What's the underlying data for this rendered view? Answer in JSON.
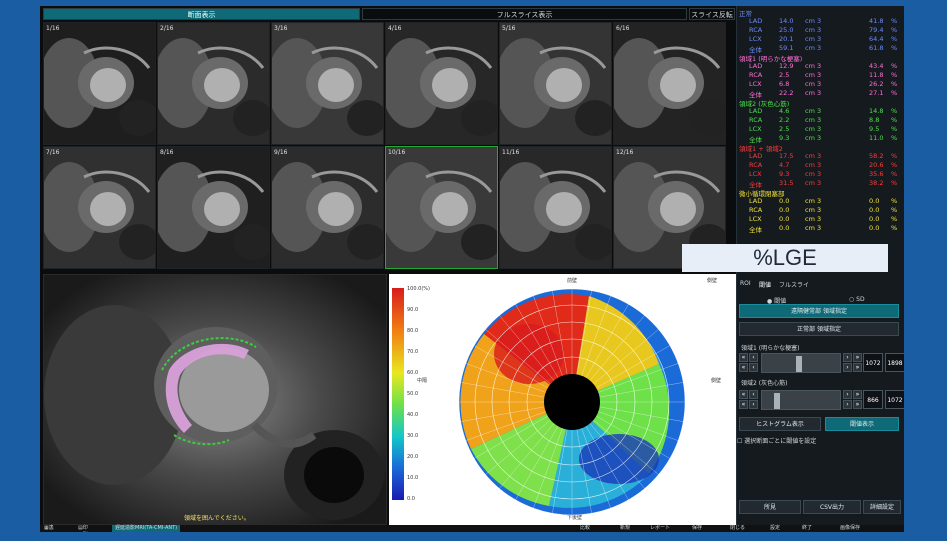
{
  "tabs": [
    {
      "label": "断面表示"
    },
    {
      "label": "フルスライス表示"
    },
    {
      "label": "スライス反転"
    }
  ],
  "slices": [
    "1/16",
    "2/16",
    "3/16",
    "4/16",
    "5/16",
    "6/16",
    "7/16",
    "8/16",
    "9/16",
    "10/16",
    "11/16",
    "12/16"
  ],
  "main_note": "領域を囲んでください。",
  "bullseye": {
    "top": "前壁",
    "bottom": "下後壁",
    "left": "中隔",
    "right": "側壁",
    "corner": "側壁",
    "colorbar": [
      "100.0(%)",
      "90.0",
      "80.0",
      "70.0",
      "60.0",
      "50.0",
      "40.0",
      "30.0",
      "20.0",
      "10.0",
      "0.0"
    ]
  },
  "legend": {
    "groups": [
      {
        "title": "正常",
        "color": "#6b8cff",
        "rows": [
          {
            "name": "LAD",
            "val": "14.0",
            "unit": "cm 3",
            "pct": "41.8",
            "p": "%"
          },
          {
            "name": "RCA",
            "val": "25.0",
            "unit": "cm 3",
            "pct": "79.4",
            "p": "%"
          },
          {
            "name": "LCX",
            "val": "20.1",
            "unit": "cm 3",
            "pct": "64.4",
            "p": "%"
          },
          {
            "name": "全体",
            "val": "59.1",
            "unit": "cm 3",
            "pct": "61.8",
            "p": "%"
          }
        ]
      },
      {
        "title": "領域1 (明らかな梗塞)",
        "color": "#ff6fd8",
        "rows": [
          {
            "name": "LAD",
            "val": "12.9",
            "unit": "cm 3",
            "pct": "43.4",
            "p": "%"
          },
          {
            "name": "RCA",
            "val": "2.5",
            "unit": "cm 3",
            "pct": "11.8",
            "p": "%"
          },
          {
            "name": "LCX",
            "val": "6.8",
            "unit": "cm 3",
            "pct": "26.2",
            "p": "%"
          },
          {
            "name": "全体",
            "val": "22.2",
            "unit": "cm 3",
            "pct": "27.1",
            "p": "%"
          }
        ]
      },
      {
        "title": "領域2 (灰色心筋)",
        "color": "#4ce04c",
        "rows": [
          {
            "name": "LAD",
            "val": "4.6",
            "unit": "cm 3",
            "pct": "14.8",
            "p": "%"
          },
          {
            "name": "RCA",
            "val": "2.2",
            "unit": "cm 3",
            "pct": "8.8",
            "p": "%"
          },
          {
            "name": "LCX",
            "val": "2.5",
            "unit": "cm 3",
            "pct": "9.5",
            "p": "%"
          },
          {
            "name": "全体",
            "val": "9.3",
            "unit": "cm 3",
            "pct": "11.0",
            "p": "%"
          }
        ]
      },
      {
        "title": "領域1 + 領域2",
        "color": "#ff3b3b",
        "rows": [
          {
            "name": "LAD",
            "val": "17.5",
            "unit": "cm 3",
            "pct": "58.2",
            "p": "%"
          },
          {
            "name": "RCA",
            "val": "4.7",
            "unit": "cm 3",
            "pct": "20.6",
            "p": "%"
          },
          {
            "name": "LCX",
            "val": "9.3",
            "unit": "cm 3",
            "pct": "35.6",
            "p": "%"
          },
          {
            "name": "全体",
            "val": "31.5",
            "unit": "cm 3",
            "pct": "38.2",
            "p": "%"
          }
        ]
      },
      {
        "title": "微小循環閉塞部",
        "color": "#f2e23a",
        "rows": [
          {
            "name": "LAD",
            "val": "0.0",
            "unit": "cm 3",
            "pct": "0.0",
            "p": "%"
          },
          {
            "name": "RCA",
            "val": "0.0",
            "unit": "cm 3",
            "pct": "0.0",
            "p": "%"
          },
          {
            "name": "LCX",
            "val": "0.0",
            "unit": "cm 3",
            "pct": "0.0",
            "p": "%"
          },
          {
            "name": "全体",
            "val": "0.0",
            "unit": "cm 3",
            "pct": "0.0",
            "p": "%"
          }
        ]
      }
    ]
  },
  "lge_label": "%LGE",
  "controls": {
    "tabs": [
      "ROI",
      "閾値",
      "フルスライ"
    ],
    "radio_threshold": "閾値",
    "radio_sd": "SD",
    "btn_remote_normal": "遠隔健常部 領域指定",
    "btn_normal": "正常部 領域指定",
    "region1_label": "領域1 (明らかな梗塞)",
    "region1_min": "1072",
    "region1_max": "1898",
    "region2_label": "領域2 (灰色心筋)",
    "region2_min": "866",
    "region2_max": "1072",
    "btn_histogram": "ヒストグラム表示",
    "btn_threshold_show": "閾値表示",
    "chk_slice": "選択断面ごとに閾値を設定",
    "btn_findings": "所見",
    "btn_csv": "CSV出力",
    "btn_settings": "詳細設定"
  },
  "statusbar": {
    "left1": "患者",
    "left2": "印刷",
    "tag": "遅延造影MRI(TA-CMI-ANT)",
    "r1": "比較",
    "r2": "新規",
    "r3": "レポート",
    "r4": "保存",
    "r5": "閉じる",
    "r6": "設定",
    "r7": "終了",
    "r8": "画像保存"
  },
  "colors": {
    "accent": "#0f6a78",
    "frame": "#1a5da3"
  }
}
